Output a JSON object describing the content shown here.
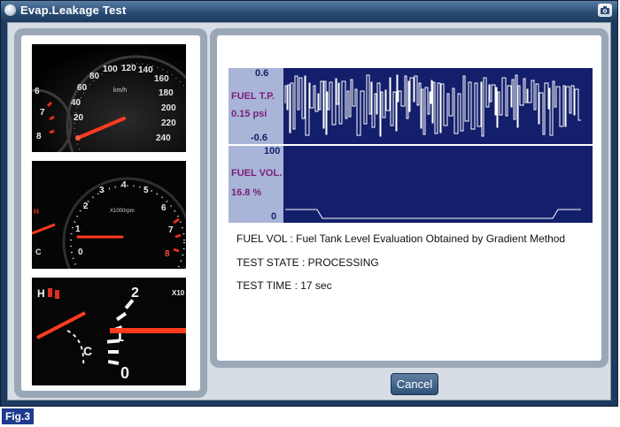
{
  "window": {
    "title": "Evap.Leakage Test"
  },
  "gauges": {
    "speedometer": {
      "unit": "km/h",
      "scale_labels": [
        "20",
        "40",
        "60",
        "80",
        "100",
        "120",
        "140",
        "160",
        "180",
        "200",
        "220",
        "240"
      ],
      "side_labels": [
        "6",
        "7",
        "8"
      ]
    },
    "tachometer": {
      "unit": "X1000rpm",
      "scale_labels": [
        "0",
        "1",
        "2",
        "3",
        "4",
        "5",
        "6",
        "7",
        "8"
      ],
      "side_labels": [
        "H",
        "C"
      ]
    },
    "tachometer_zoom": {
      "unit": "X10",
      "scale_labels": [
        "0",
        "1",
        "2"
      ],
      "side_labels": [
        "H",
        "C"
      ]
    }
  },
  "graph": {
    "fuel_tp": {
      "label": "FUEL T.P.",
      "value": "0.15 psi",
      "max": "0.6",
      "min": "-0.6"
    },
    "fuel_vol": {
      "label": "FUEL VOL.",
      "value": "16.8 %",
      "max": "100",
      "min": "0"
    },
    "colors": {
      "plot_bg": "#141f6b",
      "label_bg": "#a9b5d8",
      "label_text": "#7a1f7a",
      "trace": "#ffffff"
    }
  },
  "info": {
    "fuel_vol_desc": "FUEL VOL : Fuel Tank Level Evaluation Obtained by Gradient Method",
    "test_state": "TEST STATE : PROCESSING",
    "test_time": "TEST TIME : 17 sec"
  },
  "buttons": {
    "cancel": "Cancel"
  },
  "figure_label": "Fig.3"
}
